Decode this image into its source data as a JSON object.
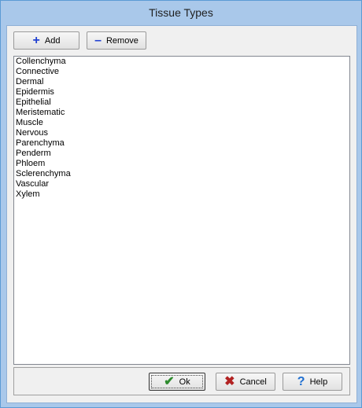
{
  "window": {
    "title": "Tissue Types"
  },
  "toolbar": {
    "add_label": "Add",
    "remove_label": "Remove"
  },
  "list": {
    "items": [
      "Collenchyma",
      "Connective",
      "Dermal",
      "Epidermis",
      "Epithelial",
      "Meristematic",
      "Muscle",
      "Nervous",
      "Parenchyma",
      "Penderm",
      "Phloem",
      "Sclerenchyma",
      "Vascular",
      "Xylem"
    ]
  },
  "footer": {
    "ok_label": "Ok",
    "cancel_label": "Cancel",
    "help_label": "Help"
  },
  "colors": {
    "add_icon": "#1f3fd1",
    "remove_icon": "#1f3fd1",
    "ok_icon": "#2e8b2e",
    "cancel_icon": "#b22222",
    "help_icon": "#1f6fd1"
  },
  "icons": {
    "add": "plus-icon",
    "remove": "minus-icon",
    "ok": "checkmark-icon",
    "cancel": "x-icon",
    "help": "question-mark-icon"
  }
}
